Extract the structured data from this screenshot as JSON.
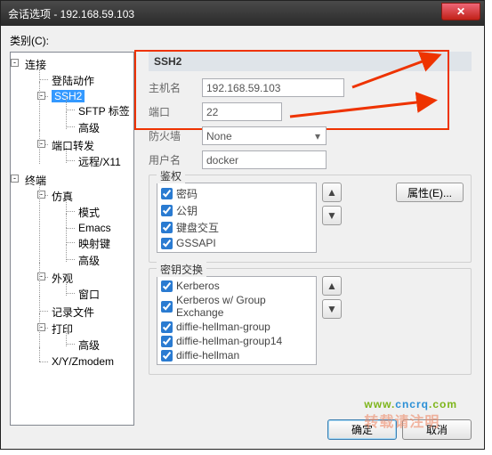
{
  "window": {
    "title": "会话选项 - 192.168.59.103"
  },
  "category_label": "类别(C):",
  "tree": {
    "n0": "连接",
    "n0_0": "登陆动作",
    "n0_1": "SSH2",
    "n0_1_0": "SFTP 标签",
    "n0_1_1": "高级",
    "n0_2": "端口转发",
    "n0_2_0": "远程/X11",
    "n1": "终端",
    "n1_0": "仿真",
    "n1_0_0": "模式",
    "n1_0_1": "Emacs",
    "n1_0_2": "映射键",
    "n1_0_3": "高级",
    "n1_1": "外观",
    "n1_1_0": "窗口",
    "n1_2": "记录文件",
    "n1_3": "打印",
    "n1_3_0": "高级",
    "n1_4": "X/Y/Zmodem"
  },
  "panel": {
    "heading": "SSH2",
    "host_label": "主机名",
    "host_value": "192.168.59.103",
    "port_label": "端口",
    "port_value": "22",
    "firewall_label": "防火墙",
    "firewall_value": "None",
    "user_label": "用户名",
    "user_value": "docker"
  },
  "auth": {
    "title": "鉴权",
    "items": [
      "密码",
      "公钥",
      "键盘交互",
      "GSSAPI"
    ],
    "props_btn": "属性(E)..."
  },
  "kex": {
    "title": "密钥交换",
    "items": [
      "Kerberos",
      "Kerberos w/ Group Exchange",
      "diffie-hellman-group",
      "diffie-hellman-group14",
      "diffie-hellman"
    ]
  },
  "buttons": {
    "ok": "确定",
    "cancel": "取消"
  },
  "watermark": {
    "line1a": "www.",
    "line1b": "cncrq",
    "line1c": ".com",
    "line2": "转载请注明"
  }
}
